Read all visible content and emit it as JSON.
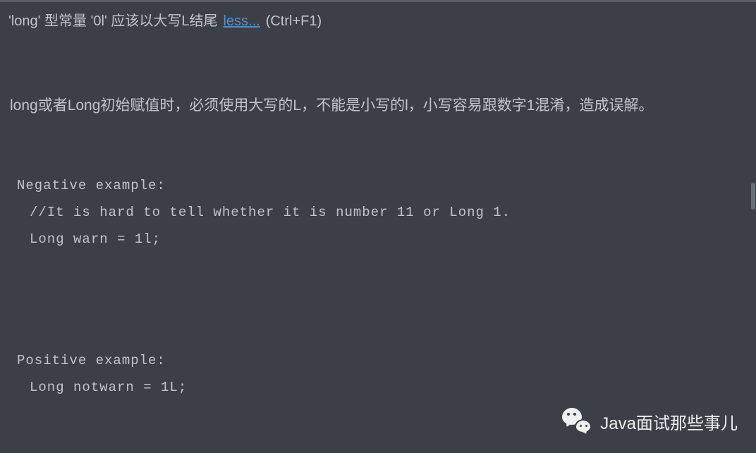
{
  "header": {
    "warning_text": "'long' 型常量 '0l' 应该以大写L结尾",
    "link_label": "less...",
    "shortcut": "(Ctrl+F1)"
  },
  "description": "long或者Long初始赋值时，必须使用大写的L，不能是小写的l，小写容易跟数字1混淆，造成误解。",
  "negative_example": {
    "title": "Negative example:",
    "comment": "//It is hard to tell whether it is number 11 or Long 1.",
    "code": "Long warn = 1l;"
  },
  "positive_example": {
    "title": "Positive example:",
    "code": "Long notwarn = 1L;"
  },
  "watermark": {
    "text": "Java面试那些事儿"
  }
}
